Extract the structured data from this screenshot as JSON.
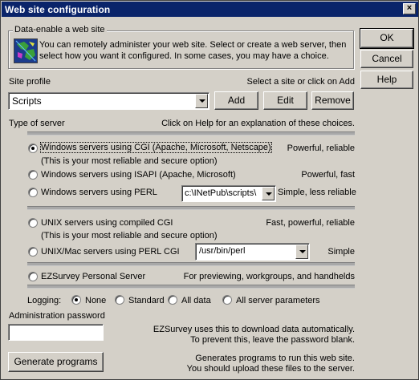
{
  "window": {
    "title": "Web site configuration",
    "close_glyph": "×"
  },
  "buttons": {
    "ok": "OK",
    "cancel": "Cancel",
    "help": "Help"
  },
  "enable_group": {
    "legend": "Data-enable a web site",
    "text": "You can remotely administer  your web site. Select or create a web server, then select how you want it configured. In some cases, you may have a choice."
  },
  "profile": {
    "label": "Site profile",
    "hint": "Select a site or click on Add",
    "selected": "Scripts",
    "add": "Add",
    "edit": "Edit",
    "remove": "Remove"
  },
  "server": {
    "label": "Type of server",
    "hint": "Click on Help for an explanation of these choices.",
    "options": [
      {
        "label": "Windows servers using CGI (Apache, Microsoft, Netscape)",
        "sub": "(This is your most reliable and secure option)",
        "note": "Powerful, reliable",
        "selected": true
      },
      {
        "label": "Windows servers using ISAPI (Apache, Microsoft)",
        "note": "Powerful, fast",
        "selected": false
      },
      {
        "label": "Windows servers using PERL",
        "path": "c:\\INetPub\\scripts\\",
        "note": "Simple, less reliable",
        "selected": false
      },
      {
        "label": "UNIX servers using compiled CGI",
        "sub": "(This is your most reliable and secure option)",
        "note": "Fast, powerful, reliable",
        "selected": false
      },
      {
        "label": "UNIX/Mac servers using PERL CGI",
        "path": "/usr/bin/perl",
        "note": "Simple",
        "selected": false
      },
      {
        "label": "EZSurvey Personal Server",
        "note": "For previewing, workgroups, and handhelds",
        "selected": false
      }
    ]
  },
  "logging": {
    "label": "Logging:",
    "options": [
      "None",
      "Standard",
      "All data",
      "All server parameters"
    ],
    "selected": "None"
  },
  "password": {
    "label": "Administration password",
    "value": "",
    "note1": "EZSurvey uses this to download data automatically.",
    "note2": "To prevent this, leave the password blank."
  },
  "generate": {
    "button": "Generate programs",
    "note1": "Generates programs to run this web site.",
    "note2": "You should upload these files to the server."
  }
}
